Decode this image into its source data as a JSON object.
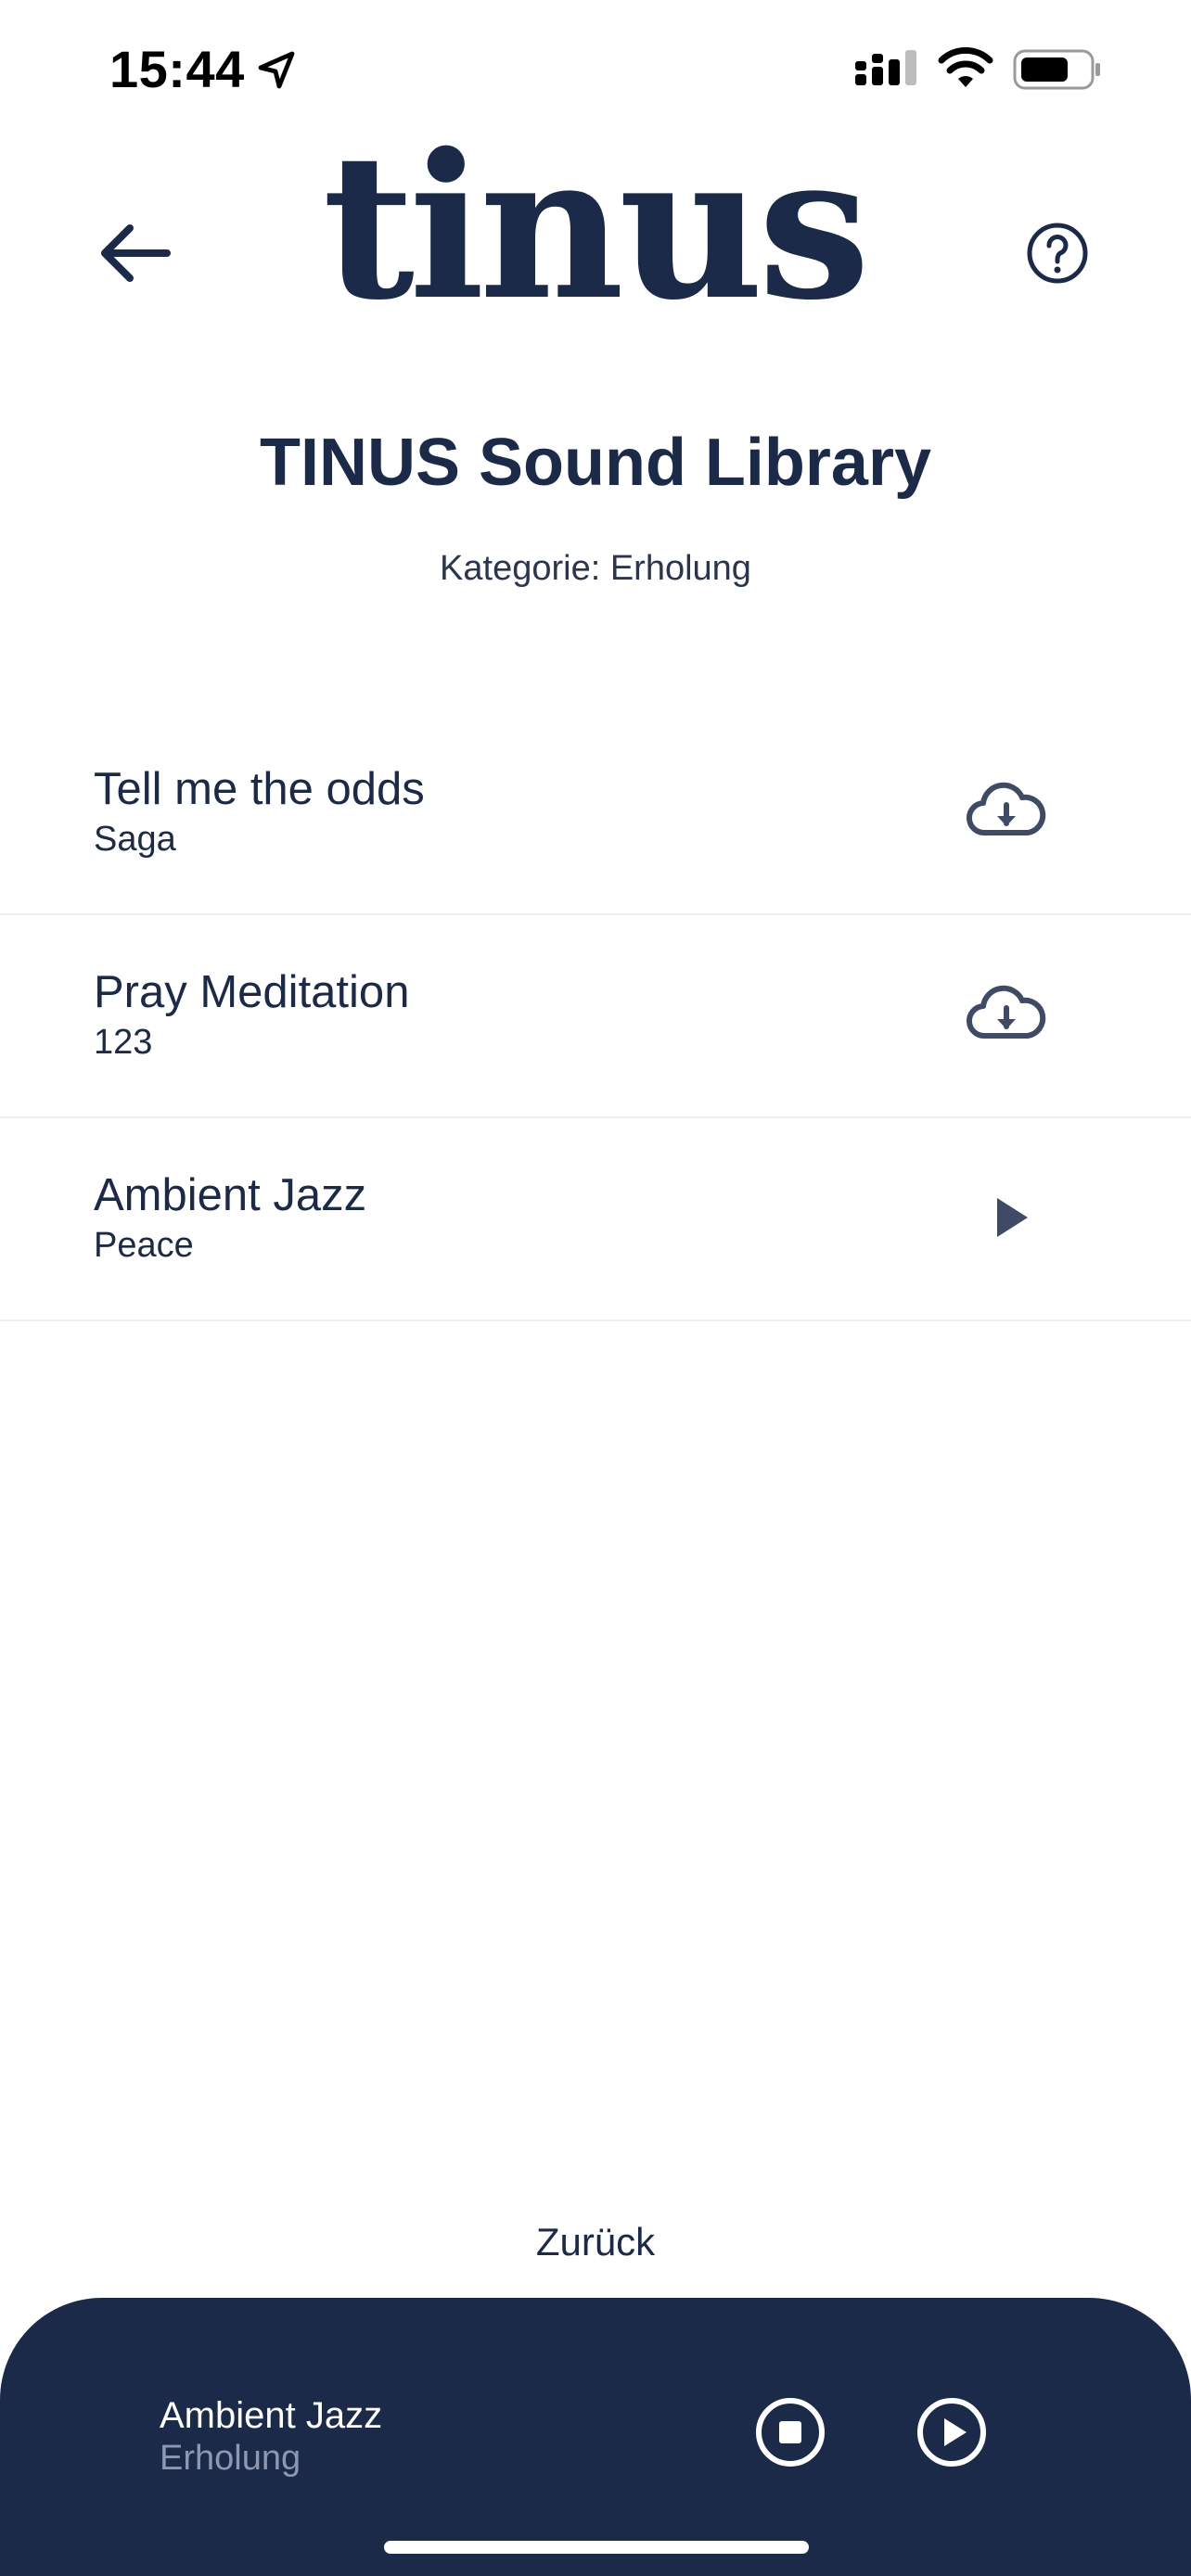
{
  "status_bar": {
    "time": "15:44",
    "icons": [
      "location-arrow-icon",
      "cellular-signal-icon",
      "wifi-icon",
      "battery-icon"
    ]
  },
  "header": {
    "logo_text": "tinus",
    "back_icon": "arrow-left-icon",
    "help_icon": "question-circle-icon"
  },
  "page": {
    "title": "TINUS Sound Library",
    "category_label": "Kategorie: Erholung"
  },
  "tracks": [
    {
      "title": "Tell me the odds",
      "subtitle": "Saga",
      "action_icon": "cloud-download-icon"
    },
    {
      "title": "Pray Meditation",
      "subtitle": "123",
      "action_icon": "cloud-download-icon"
    },
    {
      "title": "Ambient Jazz",
      "subtitle": "Peace",
      "action_icon": "play-icon"
    }
  ],
  "footer": {
    "back_label": "Zurück"
  },
  "player": {
    "title": "Ambient Jazz",
    "category": "Erholung",
    "stop_icon": "stop-circle-icon",
    "play_icon": "play-circle-icon"
  },
  "colors": {
    "brand_navy": "#1c2a4a",
    "background": "#ffffff",
    "divider": "#eeeef0",
    "player_subtext": "#8d97b0",
    "icon_gray": "#3e4a66"
  }
}
